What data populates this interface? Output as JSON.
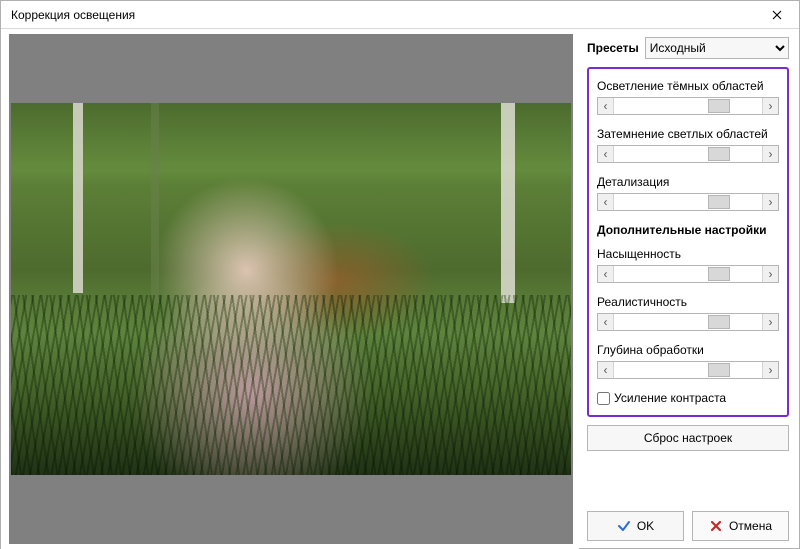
{
  "window": {
    "title": "Коррекция освещения"
  },
  "presets": {
    "label": "Пресеты",
    "selected": "Исходный",
    "options": [
      "Исходный"
    ]
  },
  "sliders": {
    "shadows": {
      "label": "Осветление тёмных областей",
      "pos": 71
    },
    "highlights": {
      "label": "Затемнение светлых областей",
      "pos": 71
    },
    "detail": {
      "label": "Детализация",
      "pos": 71
    }
  },
  "advanced": {
    "header": "Дополнительные настройки",
    "saturation": {
      "label": "Насыщенность",
      "pos": 71
    },
    "realism": {
      "label": "Реалистичность",
      "pos": 71
    },
    "depth": {
      "label": "Глубина обработки",
      "pos": 71
    }
  },
  "contrast_boost": {
    "label": "Усиление контраста",
    "checked": false
  },
  "reset": {
    "label": "Сброс настроек"
  },
  "buttons": {
    "ok": "OK",
    "cancel": "Отмена"
  }
}
